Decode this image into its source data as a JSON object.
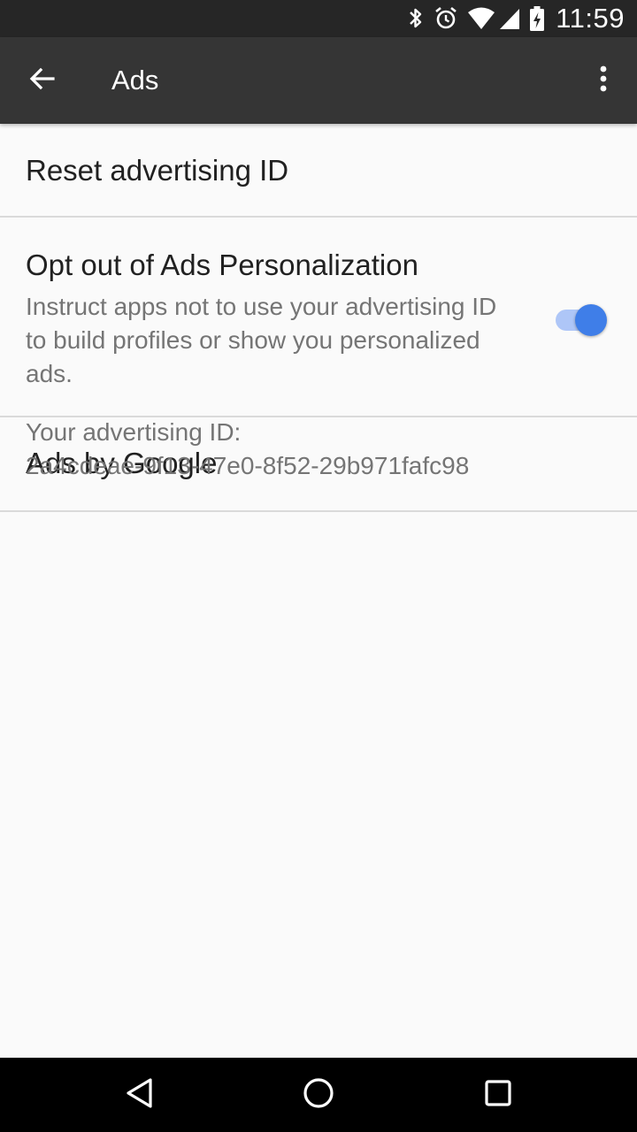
{
  "status_bar": {
    "time": "11:59",
    "icons": [
      "bluetooth-icon",
      "alarm-icon",
      "wifi-icon",
      "cell-signal-icon",
      "battery-charging-icon"
    ]
  },
  "app_bar": {
    "title": "Ads",
    "back_icon": "arrow-back-icon",
    "overflow_icon": "more-vert-icon"
  },
  "preferences": [
    {
      "title": "Reset advertising ID"
    },
    {
      "title": "Opt out of Ads Personalization",
      "summary": "Instruct apps not to use your advertising ID to build profiles or show you personalized ads.",
      "toggle_on": true
    },
    {
      "title": "Ads by Google"
    }
  ],
  "advertising_id": {
    "label": "Your advertising ID:",
    "value": "2a4cdeae-9f13-47e0-8f52-29b971fafc98"
  },
  "nav_bar": {
    "icons": [
      "back-triangle-icon",
      "home-circle-icon",
      "recents-square-icon"
    ]
  },
  "colors": {
    "status_bar": "#262626",
    "app_bar": "#353535",
    "background": "#fafafa",
    "accent": "#3f7ee8",
    "divider": "#dadada"
  }
}
